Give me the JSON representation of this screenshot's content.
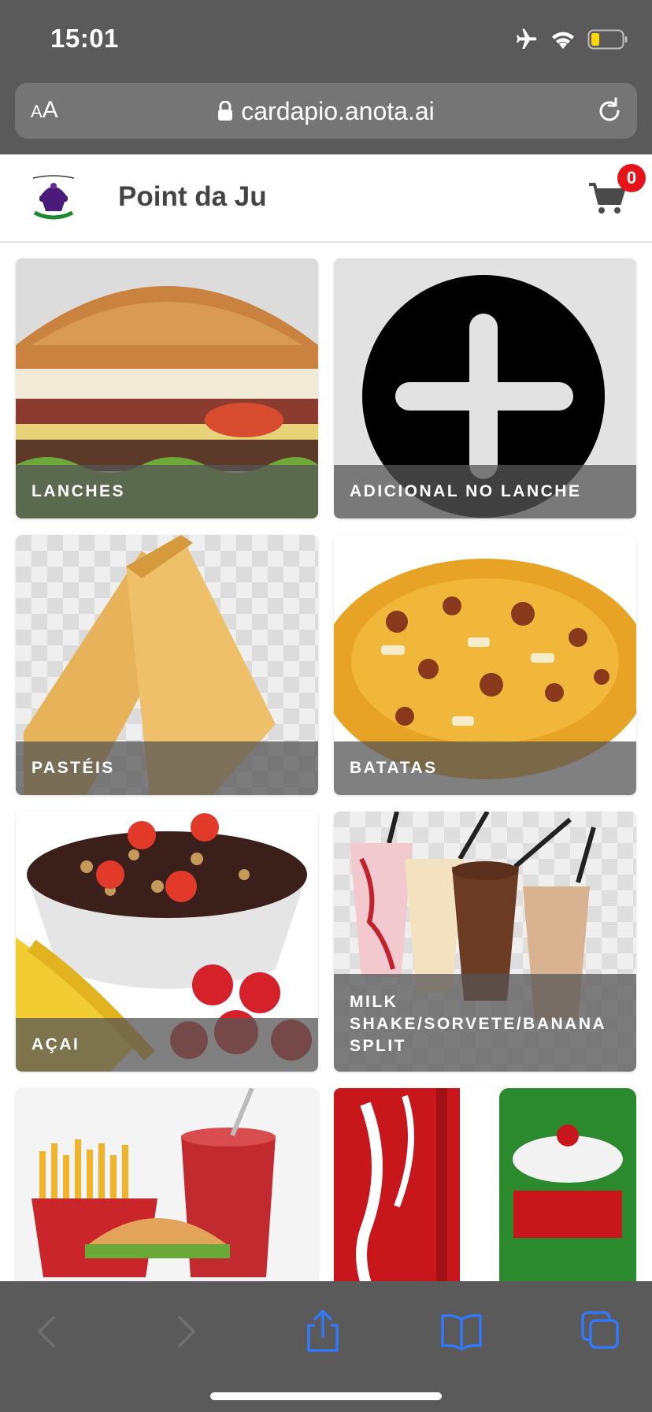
{
  "status": {
    "time": "15:01"
  },
  "browser": {
    "aa_label_small": "A",
    "aa_label_large": "A",
    "url": "cardapio.anota.ai"
  },
  "header": {
    "title": "Point da Ju",
    "cart_count": "0"
  },
  "categories": [
    {
      "label": "LANCHES"
    },
    {
      "label": "ADICIONAL NO LANCHE"
    },
    {
      "label": "PASTÉIS"
    },
    {
      "label": "BATATAS"
    },
    {
      "label": "AÇAI"
    },
    {
      "label": "MILK SHAKE/SORVETE/BANANA SPLIT"
    },
    {
      "label": ""
    },
    {
      "label": ""
    }
  ],
  "colors": {
    "chrome": "#5a5a5a",
    "badge": "#e5131a",
    "toolbar_icon": "#3478f6",
    "logo_purple": "#4b1b7a"
  },
  "icons": {
    "airplane": "airplane-icon",
    "wifi": "wifi-icon",
    "battery": "battery-icon",
    "lock": "lock-icon",
    "reload": "reload-icon",
    "cart": "cart-icon",
    "back": "back-icon",
    "forward": "forward-icon",
    "share": "share-icon",
    "bookmarks": "bookmarks-icon",
    "tabs": "tabs-icon"
  }
}
